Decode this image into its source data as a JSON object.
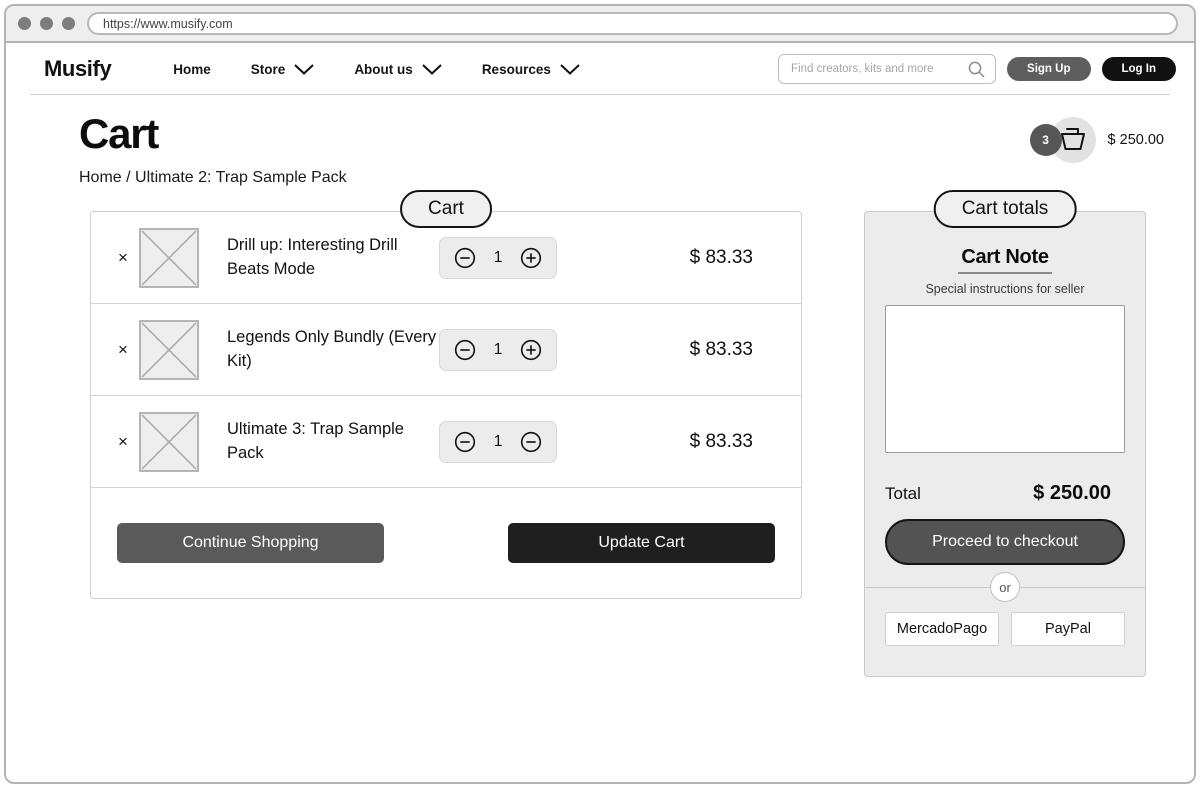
{
  "browser": {
    "url": "https://www.musify.com",
    "dots": [
      "close-dot",
      "minimize-dot",
      "maximize-dot"
    ]
  },
  "header": {
    "logo": "Musify",
    "nav": [
      {
        "label": "Home",
        "has_chevron": false
      },
      {
        "label": "Store",
        "has_chevron": true
      },
      {
        "label": "About us",
        "has_chevron": true
      },
      {
        "label": "Resources",
        "has_chevron": true
      }
    ],
    "search": {
      "placeholder": "Find creators, kits and more",
      "value": ""
    },
    "sign_up_label": "Sign Up",
    "log_in_label": "Log In"
  },
  "page": {
    "title": "Cart",
    "breadcrumb": "Home / Ultimate 2: Trap Sample Pack",
    "cart_badge_count": "3",
    "cart_total_display": "$ 250.00"
  },
  "cart": {
    "tab_label": "Cart",
    "remove_label": "×",
    "items": [
      {
        "name": "Drill up: Interesting Drill Beats Mode",
        "quantity": "1",
        "price": "$ 83.33",
        "decrement_icon": "minus-circle-icon",
        "increment_icon": "plus-circle-icon"
      },
      {
        "name": "Legends Only Bundly (Every Kit)",
        "quantity": "1",
        "price": "$ 83.33",
        "decrement_icon": "minus-circle-icon",
        "increment_icon": "plus-circle-icon"
      },
      {
        "name": "Ultimate 3: Trap Sample Pack",
        "quantity": "1",
        "price": "$ 83.33",
        "decrement_icon": "minus-circle-icon",
        "increment_icon": "minus-circle-icon"
      }
    ],
    "continue_shopping_label": "Continue Shopping",
    "update_cart_label": "Update Cart"
  },
  "totals": {
    "tab_label": "Cart totals",
    "note_title": "Cart Note",
    "note_subtitle": "Special instructions for seller",
    "note_value": "",
    "total_label": "Total",
    "total_value": "$ 250.00",
    "checkout_label": "Proceed to checkout",
    "or_label": "or",
    "payment_methods": [
      "MercadoPago",
      "PayPal"
    ]
  },
  "colors": {
    "dark_button": "#1f1f1f",
    "gray_button": "#5a5a5a",
    "panel_gray": "#ececec",
    "badge_gray": "#565656",
    "border_gray": "#cfcfcf"
  }
}
